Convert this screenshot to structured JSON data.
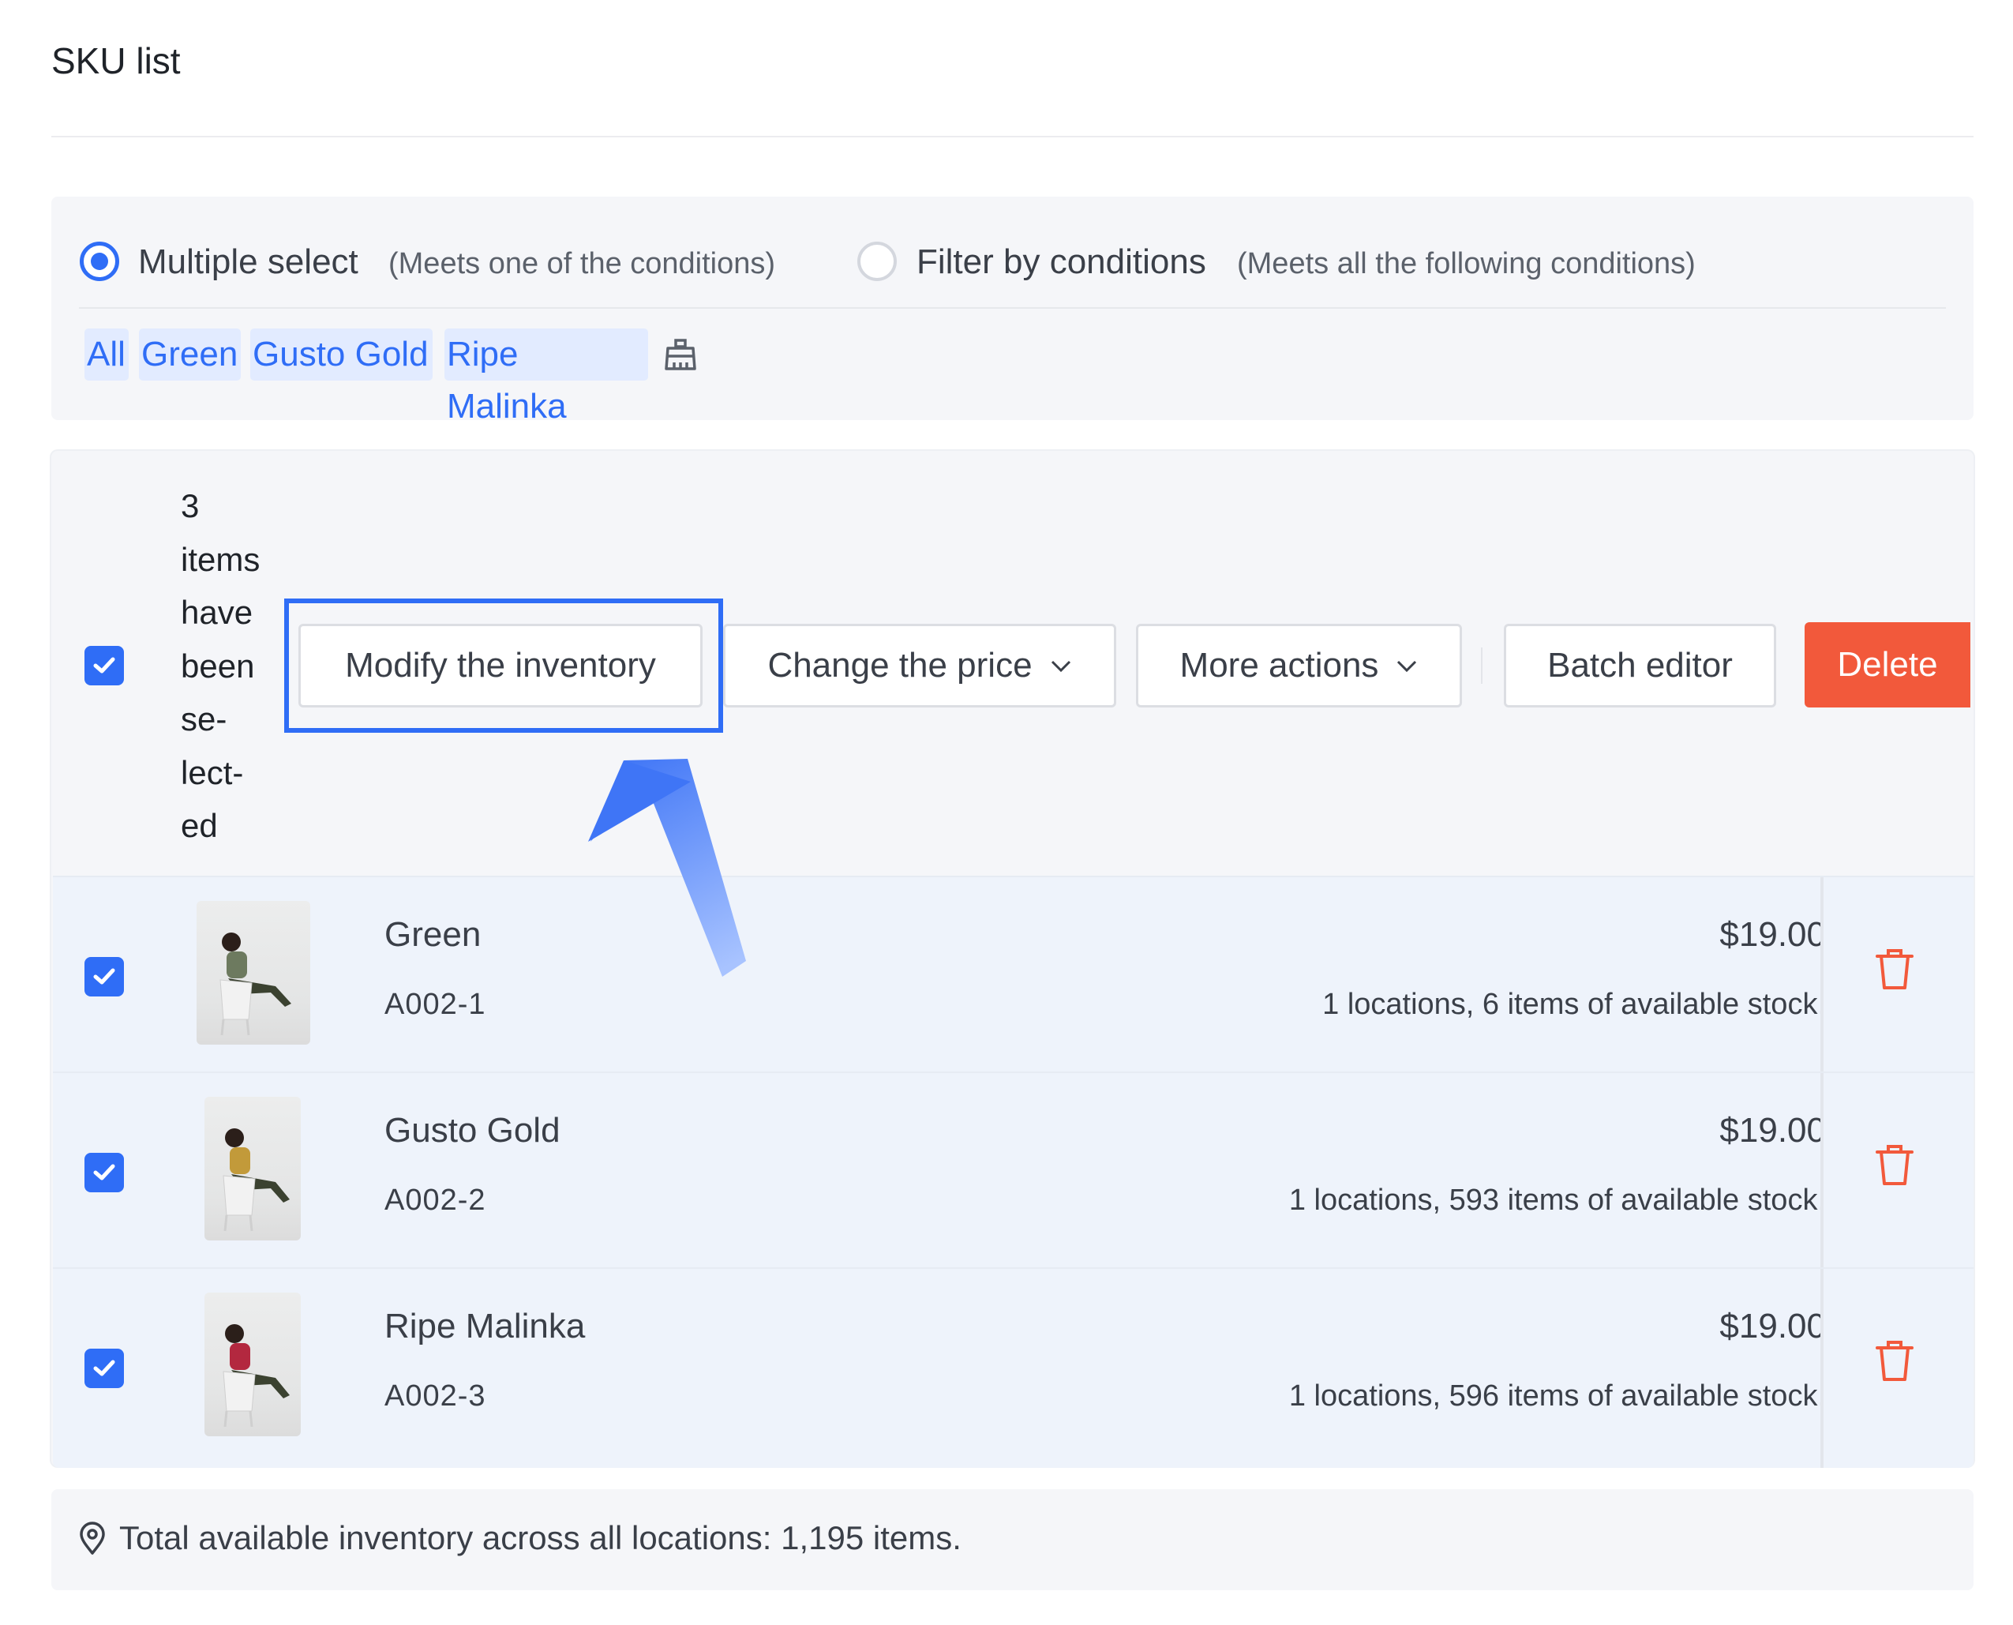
{
  "page": {
    "title": "SKU list"
  },
  "filter": {
    "modes": [
      {
        "label": "Multiple select",
        "hint": "(Meets one of the conditions)",
        "selected": true
      },
      {
        "label": "Filter by conditions",
        "hint": "(Meets all the following conditions)",
        "selected": false
      }
    ],
    "chips": [
      "All",
      "Green",
      "Gusto Gold",
      "Ripe Malinka"
    ],
    "clear_icon": "clear-broom-icon"
  },
  "bulk_bar": {
    "selected_text": "3\nitems\nhave\nbeen\nse-\nlect-\ned",
    "buttons": {
      "modify_inventory": "Modify the inventory",
      "change_price": "Change the price",
      "more_actions": "More actions",
      "batch_editor": "Batch editor",
      "delete": "Delete"
    }
  },
  "rows": [
    {
      "name": "Green",
      "sku": "A002-1",
      "price": "$19.00",
      "stock": "1 locations, 6 items of available stock.",
      "shirt_color": "#6d7a5f"
    },
    {
      "name": "Gusto Gold",
      "sku": "A002-2",
      "price": "$19.00",
      "stock": "1 locations, 593 items of available stock.",
      "shirt_color": "#c29a3a"
    },
    {
      "name": "Ripe Malinka",
      "sku": "A002-3",
      "price": "$19.00",
      "stock": "1 locations, 596 items of available stock.",
      "shirt_color": "#b3283f"
    }
  ],
  "footer": {
    "total_text": "Total available inventory across all locations: 1,195 items."
  },
  "colors": {
    "accent": "#2f6df6",
    "danger": "#f2593b"
  }
}
